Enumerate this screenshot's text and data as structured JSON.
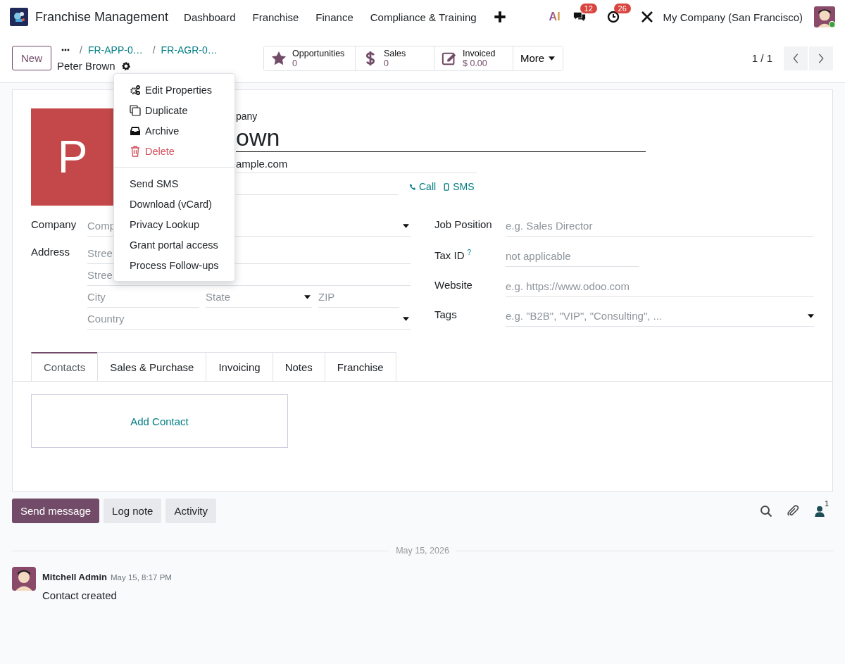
{
  "app": {
    "name": "Franchise Management"
  },
  "menu": [
    "Dashboard",
    "Franchise",
    "Finance",
    "Compliance & Training"
  ],
  "systray": {
    "ai": "AI",
    "messages": "12",
    "activities": "26",
    "company": "My Company (San Francisco)"
  },
  "new_button": "New",
  "breadcrumbs": [
    {
      "label": "FR-APP-0…",
      "separator": "/"
    },
    {
      "label": "FR-AGR-0…",
      "separator": "/"
    }
  ],
  "record_name": "Peter Brown",
  "stat_buttons": [
    {
      "kind": "star",
      "label": "Opportunities",
      "value": "0"
    },
    {
      "kind": "dollar",
      "label": "Sales",
      "value": "0"
    },
    {
      "kind": "invoice",
      "label": "Invoiced",
      "value": "$ 0.00"
    }
  ],
  "more_button": "More",
  "pager": "1 / 1",
  "action_menu": [
    [
      {
        "kind": "properties",
        "label": "Edit Properties",
        "danger": false
      },
      {
        "kind": "duplicate",
        "label": "Duplicate",
        "danger": false
      },
      {
        "kind": "archive",
        "label": "Archive",
        "danger": false
      },
      {
        "kind": "delete",
        "label": "Delete",
        "danger": true
      }
    ],
    [
      {
        "kind": "action",
        "label": "Send SMS",
        "danger": false
      },
      {
        "kind": "action",
        "label": "Download (vCard)",
        "danger": false
      },
      {
        "kind": "action",
        "label": "Privacy Lookup",
        "danger": false
      },
      {
        "kind": "action",
        "label": "Grant portal access",
        "danger": false
      },
      {
        "kind": "action",
        "label": "Process Follow-ups",
        "danger": false
      }
    ]
  ],
  "form": {
    "avatar_letter": "P",
    "type_label": "pany",
    "name": "own",
    "email": "ample.com",
    "call": "Call",
    "sms": "SMS",
    "company": {
      "label": "Company",
      "placeholder": "Comp"
    },
    "address": {
      "label": "Address",
      "street": "Stree",
      "street2": "Stree",
      "city": "City",
      "state": "State",
      "zip": "ZIP",
      "country": "Country"
    },
    "right_fields": [
      {
        "label": "Job Position",
        "placeholder": "e.g. Sales Director",
        "kind": "text"
      },
      {
        "label": "Tax ID",
        "help": "?",
        "placeholder": "not applicable",
        "kind": "narrow"
      },
      {
        "label": "Website",
        "placeholder": "e.g. https://www.odoo.com",
        "kind": "text"
      },
      {
        "label": "Tags",
        "placeholder": "e.g. \"B2B\", \"VIP\", \"Consulting\", ...",
        "kind": "select"
      }
    ]
  },
  "tabs": [
    {
      "label": "Contacts",
      "selected": true
    },
    {
      "label": "Sales & Purchase",
      "selected": false
    },
    {
      "label": "Invoicing",
      "selected": false
    },
    {
      "label": "Notes",
      "selected": false
    },
    {
      "label": "Franchise",
      "selected": false
    }
  ],
  "add_contact": "Add Contact",
  "chatter": {
    "buttons": [
      {
        "label": "Send message",
        "kind": "primary"
      },
      {
        "label": "Log note",
        "kind": "secondary"
      },
      {
        "label": "Activity",
        "kind": "secondary"
      }
    ],
    "followers": "1",
    "date": "May 15, 2026",
    "messages": [
      {
        "author": "Mitchell Admin",
        "time": "May 15, 8:17 PM",
        "body": "Contact created"
      }
    ]
  }
}
